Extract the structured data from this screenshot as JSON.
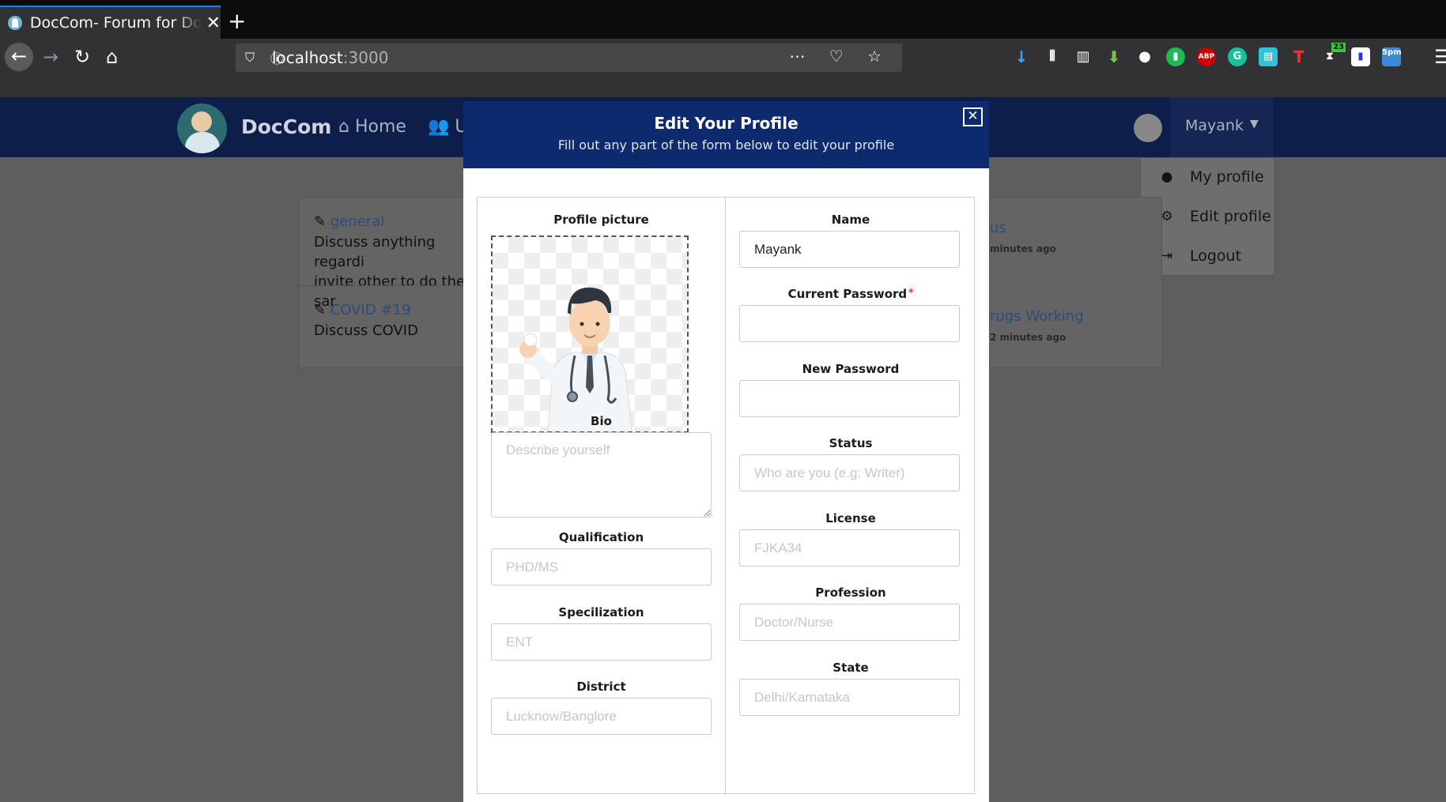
{
  "browser": {
    "tab_title": "DocCom- Forum for Doctors",
    "tab_close": "✕",
    "new_tab": "+",
    "url_host": "localhost",
    "url_port": ":3000",
    "extension_badges": {
      "counter": "23",
      "clock": "5pm"
    }
  },
  "app": {
    "brand": "DocCom",
    "nav_home": "Home",
    "nav_users": "Users",
    "user_name": "Mayank"
  },
  "dropdown": {
    "items": [
      {
        "label": "My profile",
        "icon": "user-icon"
      },
      {
        "label": "Edit profile",
        "icon": "gear-icon"
      },
      {
        "label": "Logout",
        "icon": "sign-out-icon"
      }
    ]
  },
  "background": {
    "left_card": [
      {
        "title": "general",
        "text_line1": "Discuss anything regardi",
        "text_line2": "invite other to do the sar"
      },
      {
        "title": "COVID #19",
        "text_line1": "Discuss COVID"
      }
    ],
    "right_card": [
      {
        "title": "us",
        "meta": "minutes ago"
      },
      {
        "title": "rugs Working",
        "meta": "2 minutes ago"
      }
    ]
  },
  "modal": {
    "title": "Edit Your Profile",
    "subtitle": "Fill out any part of the form below to edit your profile",
    "close": "✕",
    "left": {
      "profile_picture_label": "Profile picture",
      "bio_label": "Bio",
      "bio_placeholder": "Describe yourself",
      "qualification_label": "Qualification",
      "qualification_placeholder": "PHD/MS",
      "specialization_label": "Specilization",
      "specialization_placeholder": "ENT",
      "district_label": "District",
      "district_placeholder": "Lucknow/Banglore"
    },
    "right": {
      "name_label": "Name",
      "name_value": "Mayank",
      "current_password_label": "Current Password",
      "required_mark": "*",
      "new_password_label": "New Password",
      "status_label": "Status",
      "status_placeholder": "Who are you (e.g: Writer)",
      "license_label": "License",
      "license_placeholder": "FJKA34",
      "profession_label": "Profession",
      "profession_placeholder": "Doctor/Nurse",
      "state_label": "State",
      "state_placeholder": "Delhi/Karnataka"
    }
  },
  "colors": {
    "app_nav": "#0d1e4a",
    "modal_header": "#0d2a6e",
    "overlay": "#5e5e5e",
    "link": "#2a4d7a"
  }
}
